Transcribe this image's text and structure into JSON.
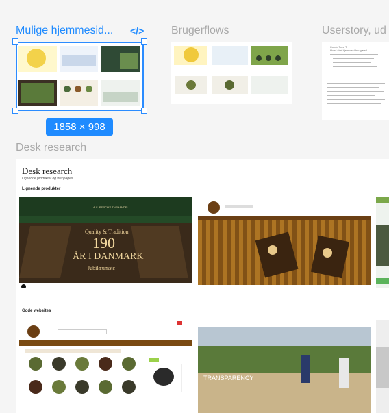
{
  "frames": {
    "mulige_label": "Mulige hjemmesid...",
    "code_icon": "</>",
    "brugerflows_label": "Brugerflows",
    "userstory_label": "Userstory, ud",
    "desk_label": "Desk research",
    "selection_dims": "1858 × 998"
  },
  "desk": {
    "title": "Desk research",
    "subtitle": "Lignende produkter og webpages",
    "section_similar": "Lignende produkter",
    "section_good": "Gode websites",
    "shot1": {
      "brand": "A.C. PERCH'S THEHANDEL",
      "line1": "Quality & Tradition",
      "line2": "190",
      "line3": "ÅR I DANMARK",
      "line4": "Jubilæumste"
    },
    "shot4": {
      "overlay": "TRANSPARENCY"
    }
  },
  "userstory": {
    "lines": [
      "Kunde Tove T.",
      "Hvad skal hjemmesiden gøre?"
    ]
  },
  "colors": {
    "accent": "#1f8bff",
    "label_gray": "#a9a9a9",
    "perch_green": "#1d3b1f",
    "perch_brown": "#6b3f14"
  }
}
